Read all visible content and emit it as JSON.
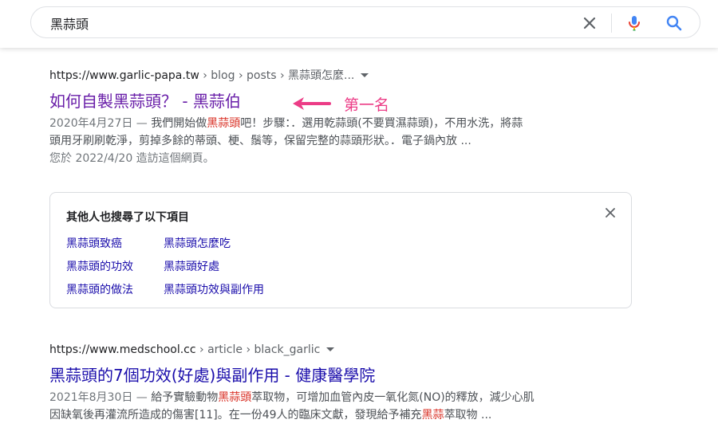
{
  "search": {
    "query": "黑蒜頭",
    "clear_icon": "close-icon",
    "mic_icon": "mic-icon",
    "search_icon": "search-icon"
  },
  "results": [
    {
      "url": "https://www.garlic-papa.tw",
      "path": " › blog › posts › 黑蒜頭怎麼...",
      "title": "如何自製黑蒜頭？ - 黑蒜伯",
      "visited": true,
      "date": "2020年4月27日 — ",
      "snippet_line1_pre": "我們開始做",
      "snippet_line1_em": "黑蒜頭",
      "snippet_line1_post": "吧！步驟：．選用乾蒜頭(不要買濕蒜頭)，不用水洗，將蒜",
      "snippet_line2": "頭用牙刷刷乾淨，剪掉多餘的蒂頭、梗、鬚等，保留完整的蒜頭形狀。．電子鍋內放 ...",
      "visit_note": "您於 2022/4/20 造訪這個網頁。"
    },
    {
      "url": "https://www.medschool.cc",
      "path": " › article › black_garlic",
      "title": "黑蒜頭的7個功效(好處)與副作用 - 健康醫學院",
      "visited": false,
      "date": "2021年8月30日 — ",
      "snippet_line1_pre": "給予實驗動物",
      "snippet_line1_em": "黑蒜頭",
      "snippet_line1_post": "萃取物，可增加血管內皮一氧化氮(NO)的釋放，減少心肌",
      "snippet_line2_pre": "因缺氧後再灌流所造成的傷害[11]。在一份49人的臨床文獻，發現給予補充",
      "snippet_line2_em": "黑蒜",
      "snippet_line2_post": "萃取物 ..."
    }
  ],
  "annotation": {
    "label": "第一名",
    "arrow_color": "#ec3c86"
  },
  "people_also_search": {
    "title": "其他人也搜尋了以下項目",
    "items": [
      "黑蒜頭致癌",
      "黑蒜頭怎麼吃",
      "黑蒜頭的功效",
      "黑蒜頭好處",
      "黑蒜頭的做法",
      "黑蒜頭功效與副作用"
    ]
  },
  "colors": {
    "link_unvisited": "#1a0dab",
    "link_visited": "#681da8",
    "emphasis": "#d93025",
    "annotation": "#ec3c86"
  }
}
